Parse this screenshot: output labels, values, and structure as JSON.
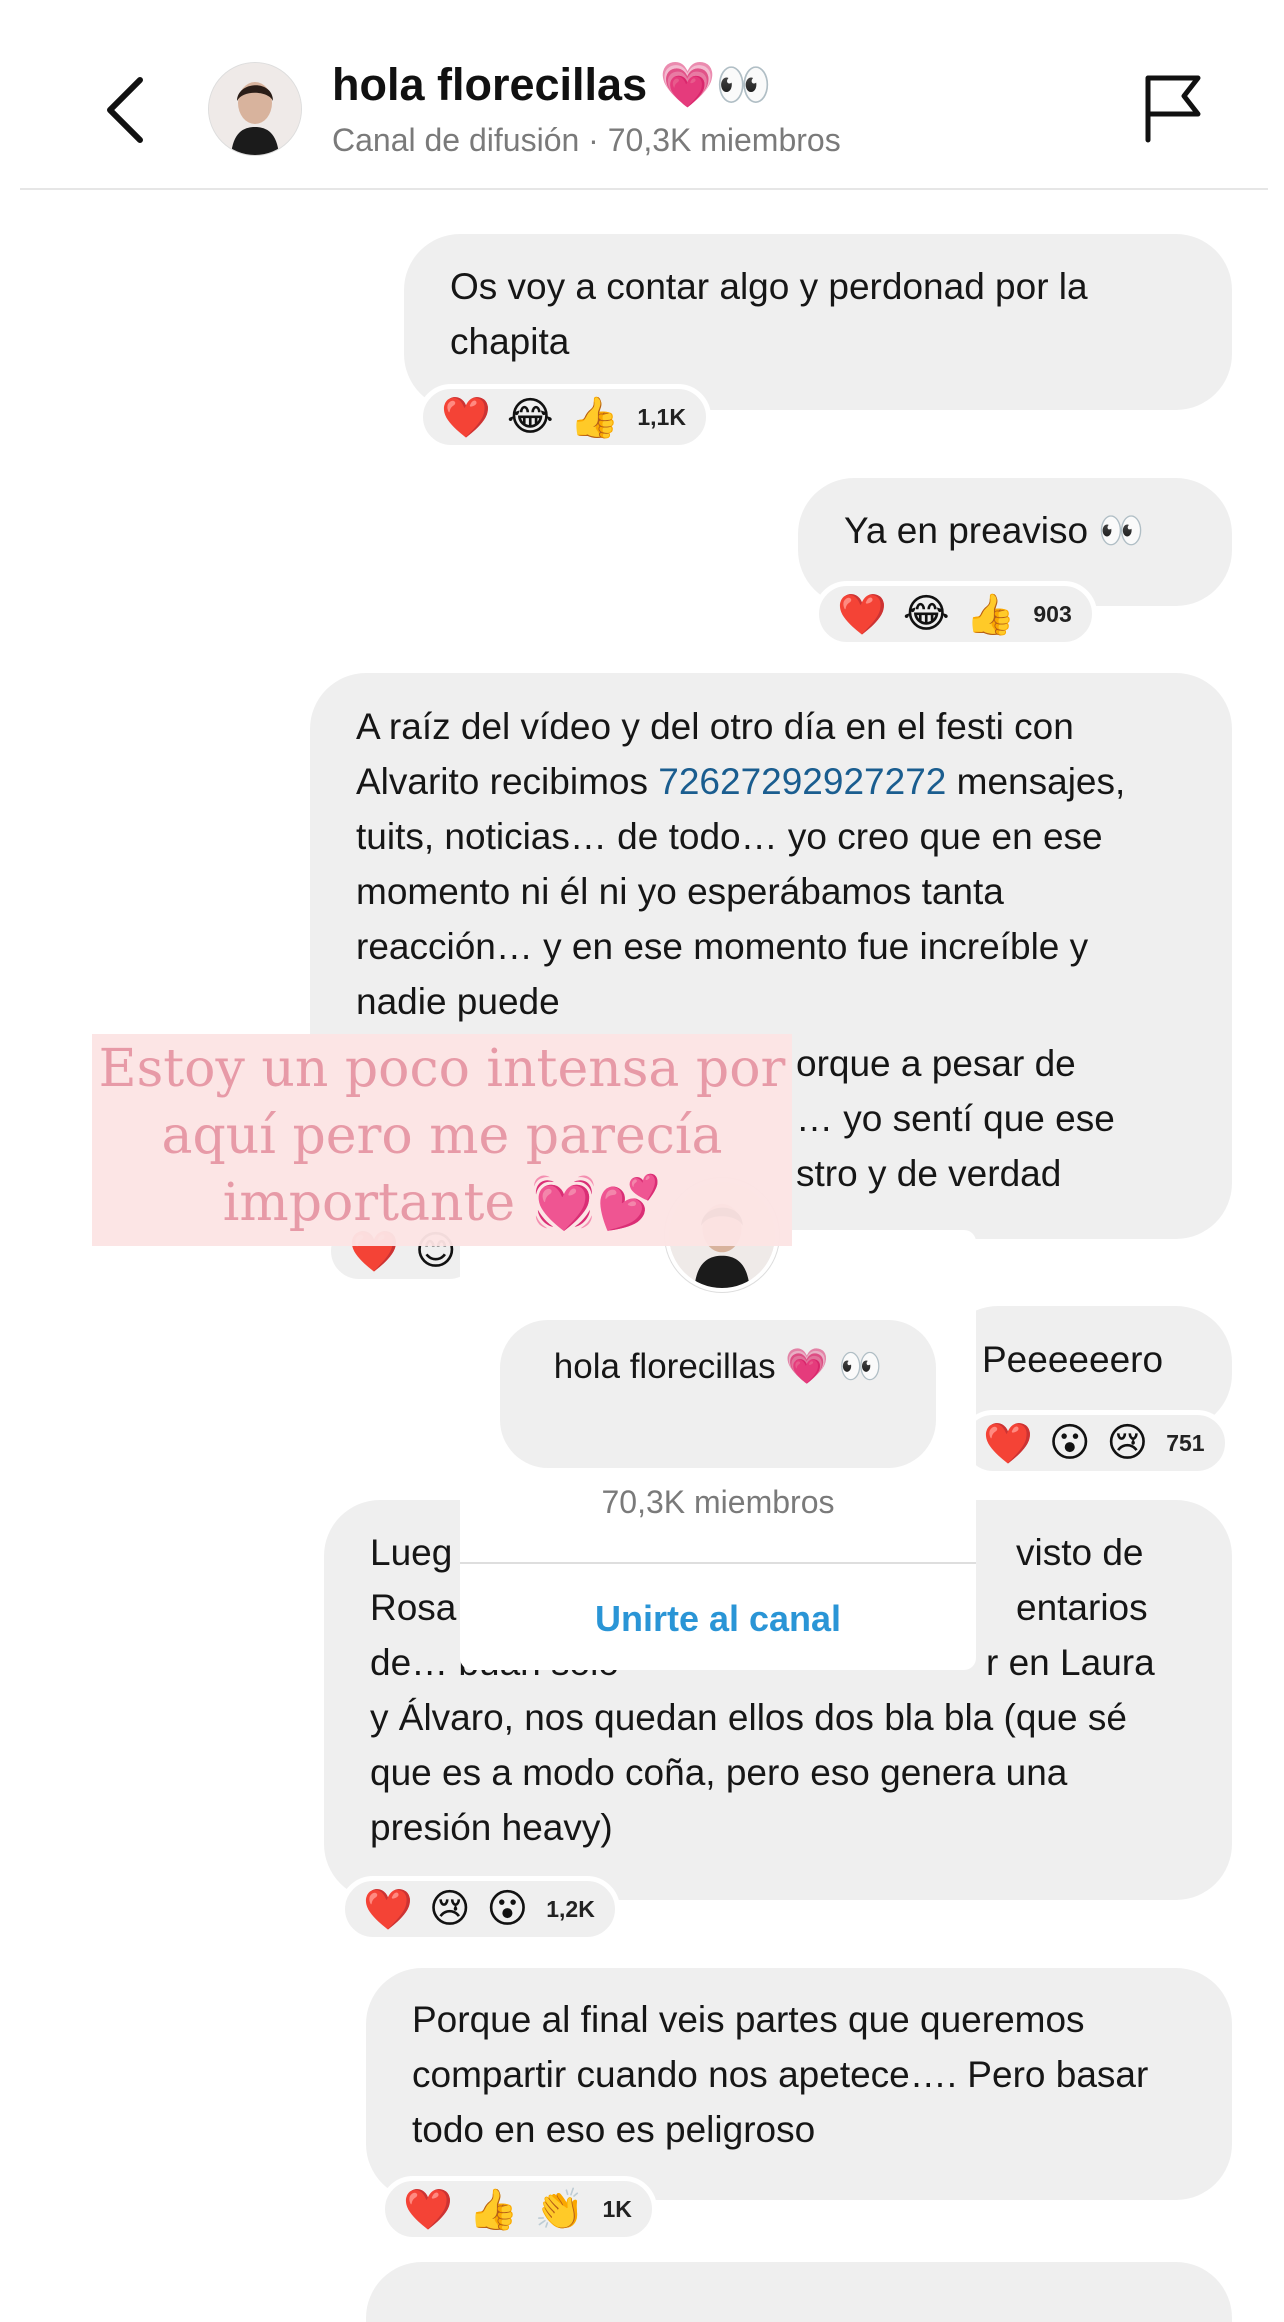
{
  "header": {
    "title": "hola florecillas 💗👀",
    "subtitle": "Canal de difusión · 70,3K miembros",
    "back_icon": "chevron-left-icon",
    "flag_icon": "flag-icon"
  },
  "messages": [
    {
      "text": "Os voy a contar algo y perdonad por la chapita",
      "reactions": [
        "❤️",
        "😂",
        "👍"
      ],
      "count": "1,1K"
    },
    {
      "text": "Ya en preaviso 👀",
      "reactions": [
        "❤️",
        "😂",
        "👍"
      ],
      "count": "903"
    },
    {
      "text_before": "A raíz del vídeo y del otro día en el festi con Alvarito recibimos ",
      "link": "72627292927272",
      "text_after": " mensajes, tuits, noticias… de todo… yo creo que en ese momento ni él ni yo esperábamos tanta reacción… y en ese momento fue increíble y nadie puede ",
      "line7": "orque a pesar de",
      "line8": "… yo sentí que ese",
      "line9": "stro y de verdad",
      "reactions": [
        "❤️",
        "😊"
      ]
    },
    {
      "text": "Peeeeeero",
      "reactions": [
        "❤️",
        "😮",
        "😢"
      ],
      "count": "751"
    },
    {
      "line1a": "Lueg",
      "line1b": "visto de",
      "line2a": "Rosa",
      "line2b": "entarios",
      "line3a": "de… buah solo",
      "line3b": "r en Laura",
      "rest": "y Álvaro, nos quedan ellos dos bla bla (que sé que es a modo coña, pero eso genera una presión heavy)",
      "reactions": [
        "❤️",
        "😢",
        "😮"
      ],
      "count": "1,2K"
    },
    {
      "text": "Porque al final veis partes que queremos compartir cuando nos apetece…. Pero basar todo en eso es peligroso",
      "reactions": [
        "❤️",
        "👍",
        "👏"
      ],
      "count": "1K"
    }
  ],
  "popup": {
    "name": "hola florecillas 💗 👀",
    "members": "70,3K miembros",
    "join_label": "Unirte al canal"
  },
  "sticker": {
    "text": "Estoy un poco intensa por aquí pero me parecía importante 💓💕"
  }
}
